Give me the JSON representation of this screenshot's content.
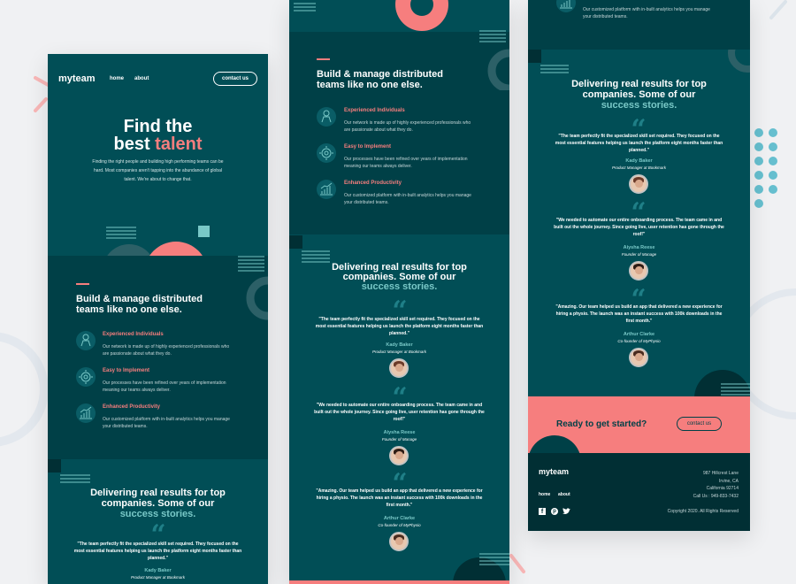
{
  "brand": {
    "logo": "myteam"
  },
  "nav": {
    "home": "home",
    "about": "about",
    "contact_btn": "contact us"
  },
  "hero": {
    "line1": "Find the",
    "line2_a": "best ",
    "line2_b": "talent",
    "text": "Finding the right people and building high performing teams can be hard. Most companies aren't tapping into the abundance of global talent. We're about to change that."
  },
  "features": {
    "heading_l1": "Build & manage distributed",
    "heading_l2": "teams like no one else.",
    "items": [
      {
        "icon": "person-icon",
        "title": "Experienced Individuals",
        "text_l1": "Our network is made up of highly experienced professionals who",
        "text_l2": "are passionate about what they do."
      },
      {
        "icon": "cogs-icon",
        "title": "Easy to Implement",
        "text_l1": "Our processes have been refined over years of implementation",
        "text_l2": "meaning our teams always deliver."
      },
      {
        "icon": "chart-icon",
        "title": "Enhanced Productivity",
        "text_l1": "Our customized platform with in-built analytics helps you manage",
        "text_l2": "your distributed teams."
      }
    ]
  },
  "results": {
    "heading_l1": "Delivering real results for top",
    "heading_l2": "companies. Some of our",
    "heading_l3": "success stories."
  },
  "testimonials": [
    {
      "l1": "\"The team perfectly fit the specialized skill set required. They focused on the",
      "l2": "most essential features helping us launch the platform eight months faster than",
      "l3": "planned.\"",
      "name": "Kady Baker",
      "role": "Product Manager at Bookmark"
    },
    {
      "l1": "\"We needed to automate our entire onboarding process. The team came in and",
      "l2": "built out the whole journey. Since going live, user retention has gone through the",
      "l3": "roof!\"",
      "name": "Aiysha Reese",
      "role": "Founder of Manage"
    },
    {
      "l1": "\"Amazing. Our team helped us build an app that delivered a new experience for",
      "l2": "hiring a physio. The launch was an instant success with 100k downloads in the",
      "l3": "first month.\"",
      "name": "Arthur Clarke",
      "role": "Co-founder of MyPhysio"
    }
  ],
  "cta": {
    "text": "Ready to get started?",
    "button": "contact us"
  },
  "footer": {
    "logo": "myteam",
    "home": "home",
    "about": "about",
    "address": [
      "987  Hillcrest Lane",
      "Irvine, CA",
      "California 92714",
      "Call Us : 949-833-7432"
    ],
    "copyright": "Copyright 2020. All Rights Reserved"
  },
  "colors": {
    "dark_teal": "#004047",
    "teal": "#014e56",
    "coral": "#f67e7e",
    "mint": "#79c8c7"
  }
}
